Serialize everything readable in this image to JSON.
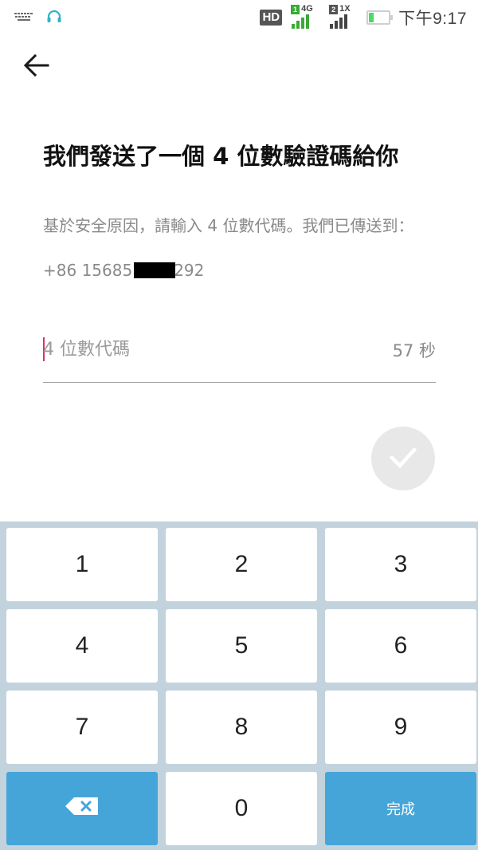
{
  "status_bar": {
    "hd_label": "HD",
    "sim1": {
      "slot": "1",
      "network": "4G"
    },
    "sim2": {
      "slot": "2",
      "network": "1X"
    },
    "battery_level_percent": 15,
    "time": "下午9:17",
    "icons": [
      "keyboard-icon",
      "headphones-icon"
    ],
    "colors": {
      "signal_green": "#3aaa35",
      "signal_gray": "#444444",
      "battery_green": "#4cd964"
    }
  },
  "header": {
    "back_icon": "arrow-left-icon"
  },
  "title": "我們發送了一個 4 位數驗證碼給你",
  "subtitle": "基於安全原因，請輸入 4 位數代碼。我們已傳送到：",
  "phone": {
    "prefix": "+86 15685",
    "suffix": "292"
  },
  "code_input": {
    "placeholder": "4 位數代碼",
    "value": "",
    "timer": "57 秒"
  },
  "confirm": {
    "icon": "check-icon",
    "enabled": false
  },
  "keypad": {
    "keys": [
      "1",
      "2",
      "3",
      "4",
      "5",
      "6",
      "7",
      "8",
      "9"
    ],
    "zero": "0",
    "backspace_icon": "backspace-icon",
    "done_label": "完成",
    "colors": {
      "background": "#c2d3dd",
      "action_blue": "#45a5d8"
    }
  }
}
